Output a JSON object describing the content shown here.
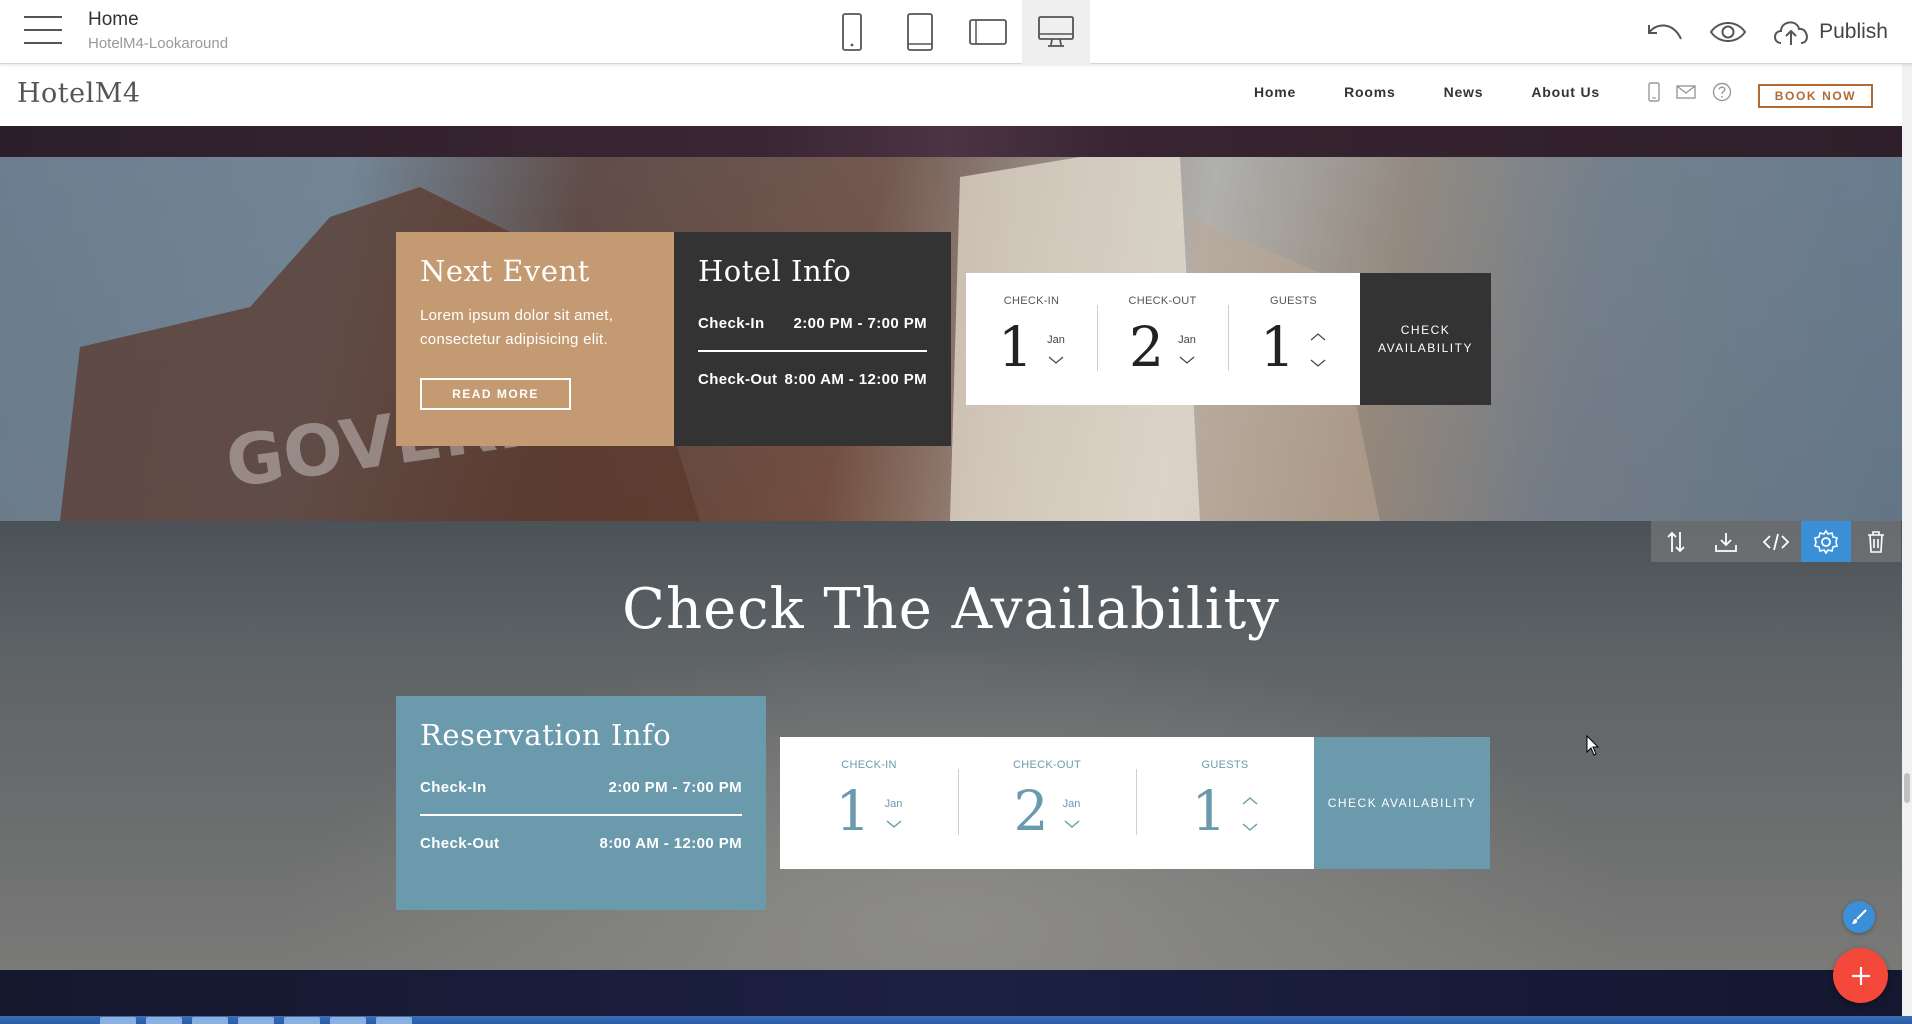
{
  "editor": {
    "page_name": "Home",
    "project_name": "HotelM4-Lookaround",
    "publish_label": "Publish",
    "devices": [
      {
        "icon": "phone-icon"
      },
      {
        "icon": "tablet-icon"
      },
      {
        "icon": "tablet-landscape-icon"
      },
      {
        "icon": "desktop-icon",
        "active": true
      }
    ]
  },
  "site": {
    "logo": "HotelM4",
    "nav": [
      "Home",
      "Rooms",
      "News",
      "About Us"
    ],
    "book_now": "BOOK NOW"
  },
  "section1": {
    "event": {
      "title": "Next Event",
      "text": "Lorem ipsum dolor sit amet, consectetur adipisicing elit.",
      "button": "READ MORE"
    },
    "hotel_info": {
      "title": "Hotel Info",
      "checkin_label": "Check-In",
      "checkin_time": "2:00 PM - 7:00 PM",
      "checkout_label": "Check-Out",
      "checkout_time": "8:00 AM - 12:00 PM"
    },
    "booking": {
      "checkin_label": "CHECK-IN",
      "checkin_day": "1",
      "checkin_month": "Jan",
      "checkout_label": "CHECK-OUT",
      "checkout_day": "2",
      "checkout_month": "Jan",
      "guests_label": "GUESTS",
      "guests": "1",
      "button": "CHECK AVAILABILITY"
    }
  },
  "section2": {
    "title": "Check The Availability",
    "reservation": {
      "title": "Reservation Info",
      "checkin_label": "Check-In",
      "checkin_time": "2:00 PM - 7:00 PM",
      "checkout_label": "Check-Out",
      "checkout_time": "8:00 AM - 12:00 PM"
    },
    "booking": {
      "checkin_label": "CHECK-IN",
      "checkin_day": "1",
      "checkin_month": "Jan",
      "checkout_label": "CHECK-OUT",
      "checkout_day": "2",
      "checkout_month": "Jan",
      "guests_label": "GUESTS",
      "guests": "1",
      "button": "CHECK AVAILABILITY"
    }
  },
  "block_toolbar": [
    "move-icon",
    "download-icon",
    "code-icon",
    "gear-icon",
    "trash-icon"
  ],
  "colors": {
    "accent_tan": "#c39a71",
    "dark_card": "#333333",
    "teal": "#6a9aac",
    "editor_blue": "#3b8fd6",
    "fab_red": "#f4493a",
    "book_now": "#b06a36"
  }
}
